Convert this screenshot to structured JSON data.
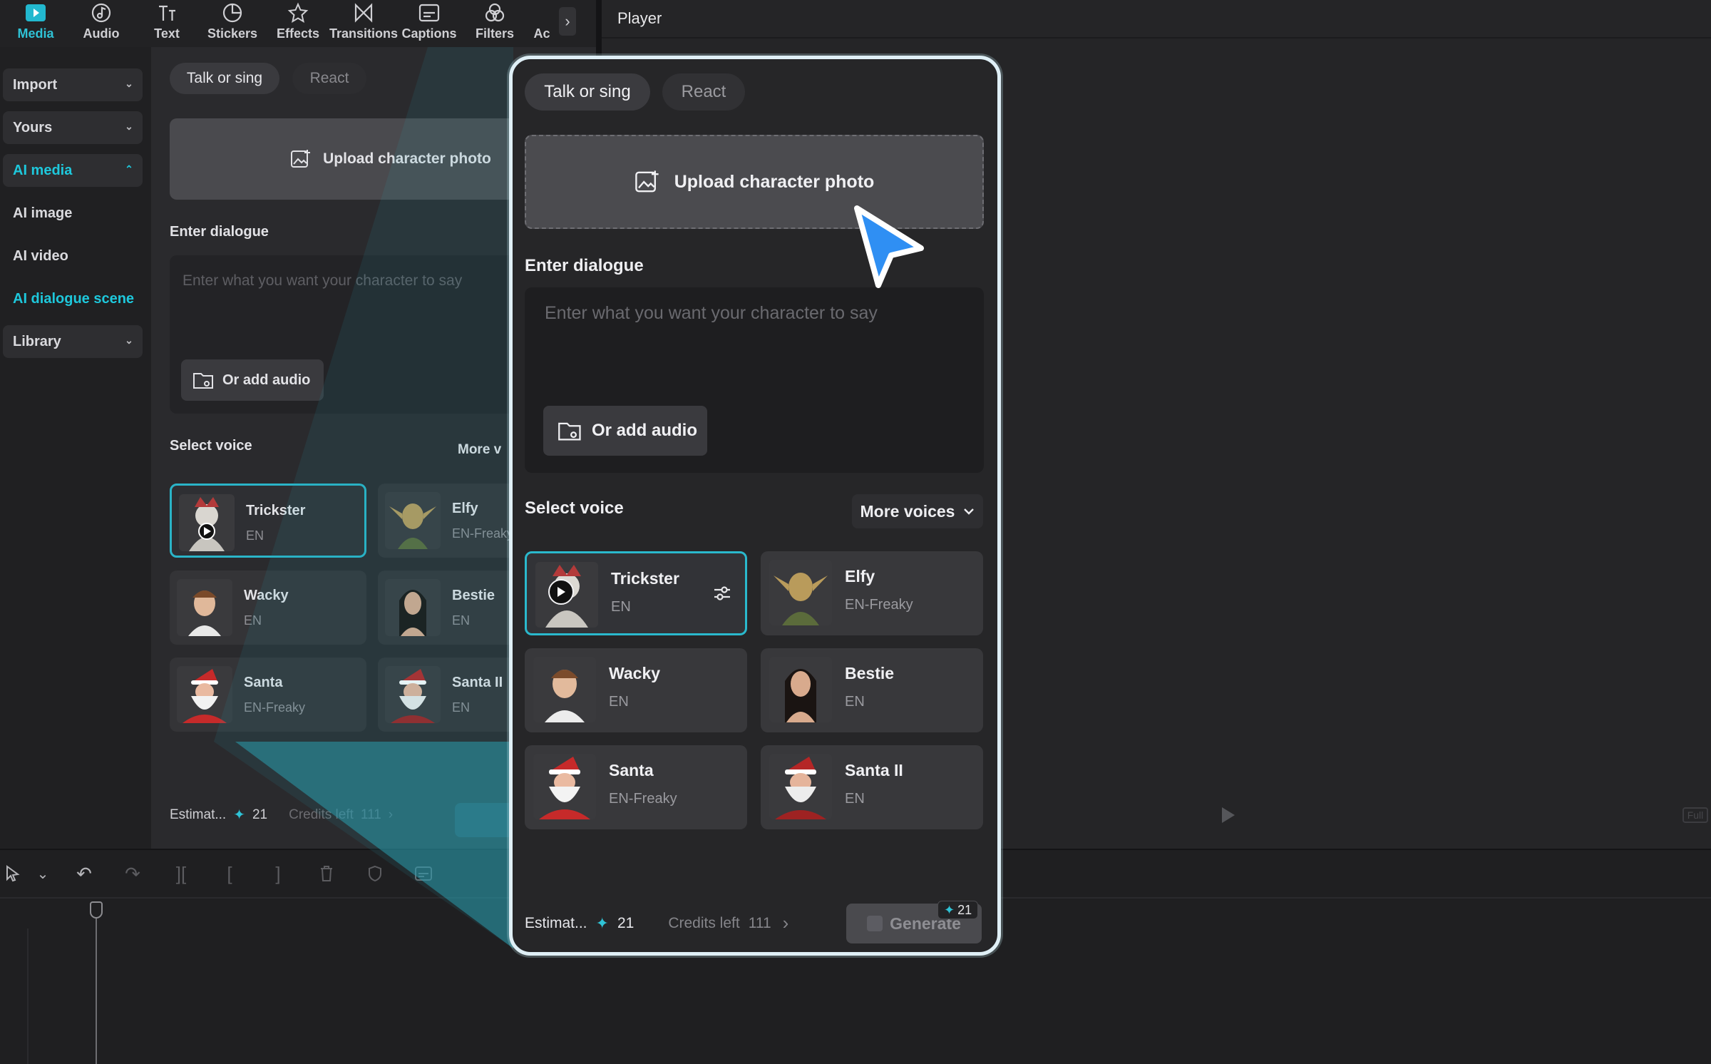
{
  "colors": {
    "accent": "#2fc3d6",
    "selected_border": "#2ab9cd",
    "panel_frame": "#dfeff6",
    "cursor": "#2f8ff3"
  },
  "toolbar": {
    "tools": [
      {
        "label": "Media",
        "icon": "media-icon",
        "active": true
      },
      {
        "label": "Audio",
        "icon": "audio-icon"
      },
      {
        "label": "Text",
        "icon": "text-icon"
      },
      {
        "label": "Stickers",
        "icon": "stickers-icon"
      },
      {
        "label": "Effects",
        "icon": "effects-icon"
      },
      {
        "label": "Transitions",
        "icon": "transitions-icon"
      },
      {
        "label": "Captions",
        "icon": "captions-icon"
      },
      {
        "label": "Filters",
        "icon": "filters-icon"
      },
      {
        "label": "Ac",
        "icon": "adjust-icon"
      }
    ],
    "more_arrow": "›"
  },
  "player": {
    "title": "Player",
    "fullscreen_label": "Full"
  },
  "sidebar": {
    "items": [
      {
        "label": "Import",
        "dropdown": true
      },
      {
        "label": "Yours",
        "dropdown": true
      },
      {
        "label": "AI media",
        "dropdown": true,
        "active": true
      },
      {
        "label": "AI image"
      },
      {
        "label": "AI video"
      },
      {
        "label": "AI dialogue scene",
        "active": true
      },
      {
        "label": "Library",
        "dropdown": true
      }
    ]
  },
  "dialogue_panel": {
    "tabs": [
      "Talk or sing",
      "React"
    ],
    "upload_label": "Upload character photo",
    "dialogue_label": "Enter dialogue",
    "dialogue_placeholder": "Enter what you want your character to say",
    "add_audio_label": "Or add audio",
    "select_voice_label": "Select voice",
    "more_voices_label": "More voices",
    "more_voices_bg_label": "More v",
    "voices": [
      {
        "name": "Trickster",
        "lang": "EN",
        "selected": true
      },
      {
        "name": "Elfy",
        "lang": "EN-Freaky"
      },
      {
        "name": "Wacky",
        "lang": "EN"
      },
      {
        "name": "Bestie",
        "lang": "EN"
      },
      {
        "name": "Santa",
        "lang": "EN-Freaky"
      },
      {
        "name": "Santa II",
        "lang": "EN"
      }
    ],
    "footer": {
      "estimate_label": "Estimat...",
      "estimate_value": "21",
      "credits_label": "Credits left",
      "credits_value": "111",
      "generate_label": "Generate",
      "generate_cost": "21"
    }
  },
  "timeline": {
    "tools": [
      "select-icon",
      "chevron-down-icon",
      "undo-icon",
      "redo-icon",
      "split-icon",
      "split-left-icon",
      "split-right-icon",
      "delete-icon",
      "shield-icon",
      "caption-icon"
    ]
  }
}
